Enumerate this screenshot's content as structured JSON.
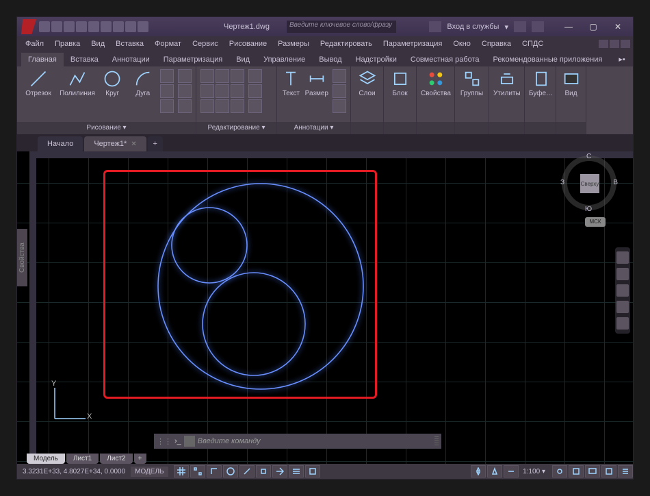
{
  "title": {
    "document": "Чертеж1.dwg",
    "search_placeholder": "Введите ключевое слово/фразу",
    "login": "Вход в службы"
  },
  "menu": [
    "Файл",
    "Правка",
    "Вид",
    "Вставка",
    "Формат",
    "Сервис",
    "Рисование",
    "Размеры",
    "Редактировать",
    "Параметризация",
    "Окно",
    "Справка",
    "СПДС"
  ],
  "ribbon_tabs": [
    "Главная",
    "Вставка",
    "Аннотации",
    "Параметризация",
    "Вид",
    "Управление",
    "Вывод",
    "Надстройки",
    "Совместная работа",
    "Рекомендованные приложения"
  ],
  "ribbon": {
    "draw": {
      "title": "Рисование ▾",
      "line": "Отрезок",
      "polyline": "Полилиния",
      "circle": "Круг",
      "arc": "Дуга"
    },
    "modify": {
      "title": "Редактирование ▾"
    },
    "annotation": {
      "title": "Аннотации ▾",
      "text": "Текст",
      "dim": "Размер"
    },
    "layers": {
      "title": "",
      "layer": "Слои"
    },
    "block": {
      "title": "",
      "block": "Блок"
    },
    "properties": {
      "title": "",
      "props": "Свойства"
    },
    "groups": {
      "title": "",
      "groups": "Группы"
    },
    "utilities": {
      "title": "",
      "util": "Утилиты"
    },
    "clipboard": {
      "title": "",
      "clip": "Буфе…"
    },
    "view": {
      "title": "",
      "view": "Вид"
    }
  },
  "doc_tabs": {
    "start": "Начало",
    "drawing": "Чертеж1*"
  },
  "side_panel": "Свойства",
  "viewcube": {
    "top": "Сверху",
    "n": "С",
    "s": "Ю",
    "e": "В",
    "w": "З",
    "wcs": "МСК"
  },
  "ucs": {
    "x": "X",
    "y": "Y"
  },
  "cmd": {
    "placeholder": "Введите команду"
  },
  "layout_tabs": [
    "Модель",
    "Лист1",
    "Лист2"
  ],
  "status": {
    "coords": "3.3231E+33, 4.8027E+34, 0.0000",
    "model": "МОДЕЛЬ",
    "scale": "1:100"
  }
}
